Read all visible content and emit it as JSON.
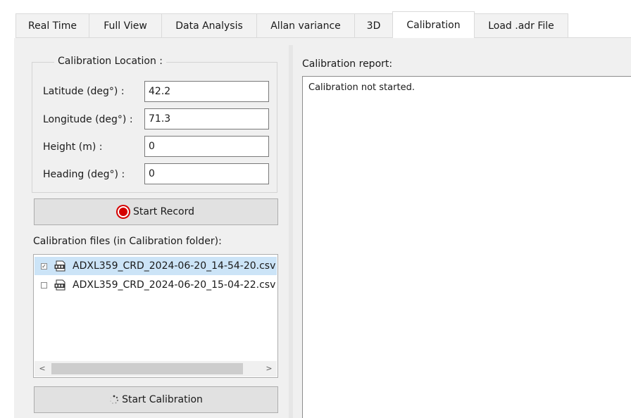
{
  "tabs": [
    {
      "label": "Real Time",
      "active": false
    },
    {
      "label": "Full View",
      "active": false
    },
    {
      "label": "Data Analysis",
      "active": false
    },
    {
      "label": "Allan variance",
      "active": false
    },
    {
      "label": "3D",
      "active": false
    },
    {
      "label": "Calibration",
      "active": true
    },
    {
      "label": "Load .adr File",
      "active": false
    }
  ],
  "location": {
    "title": "Calibration Location :",
    "latitude": {
      "label": "Latitude (deg°) :",
      "value": "42.2"
    },
    "longitude": {
      "label": "Longitude (deg°) :",
      "value": "71.3"
    },
    "height": {
      "label": "Height (m) :",
      "value": "0"
    },
    "heading": {
      "label": "Heading (deg°) :",
      "value": "0"
    }
  },
  "record_button": {
    "label": "Start Record",
    "icon": "record-icon"
  },
  "files": {
    "label": "Calibration files (in Calibration folder):",
    "items": [
      {
        "name": "ADXL359_CRD_2024-06-20_14-54-20.csv",
        "checked": true,
        "selected": true,
        "icon": "csv-file-icon"
      },
      {
        "name": "ADXL359_CRD_2024-06-20_15-04-22.csv",
        "checked": false,
        "selected": false,
        "icon": "csv-file-icon"
      }
    ]
  },
  "calibrate_button": {
    "label": "Start Calibration",
    "icon": "spinner-icon"
  },
  "report": {
    "label": "Calibration report:",
    "text": "Calibration not started."
  },
  "colors": {
    "panel_bg": "#f0f0f0",
    "selection": "#cce4f7",
    "record_red": "#d40000",
    "button_bg": "#e1e1e1"
  }
}
